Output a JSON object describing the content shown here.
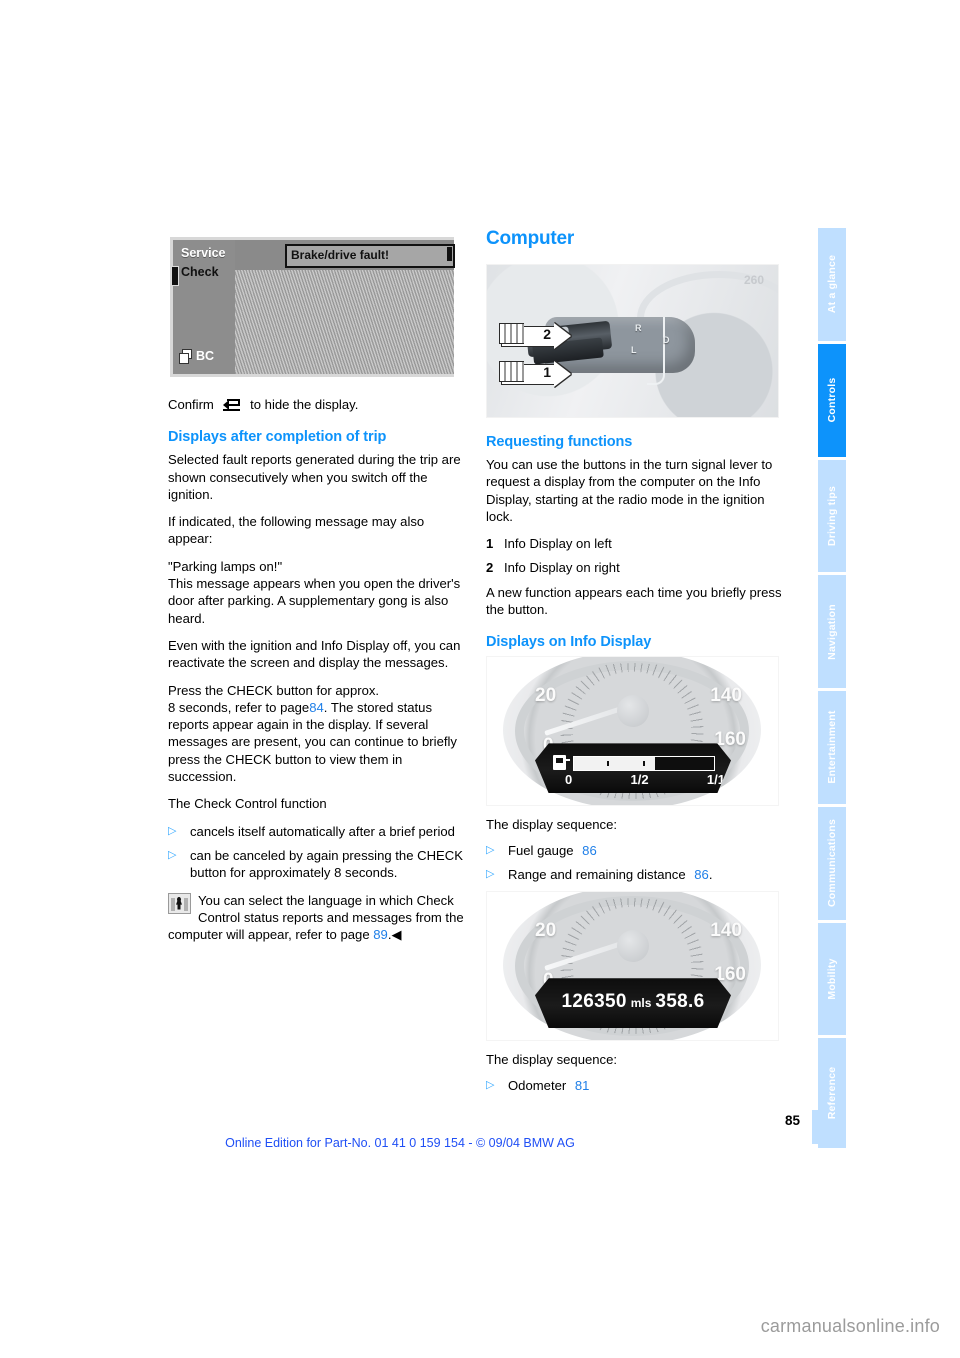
{
  "document": {
    "page_number": "85",
    "footer_note": "Online Edition for Part-No. 01 41 0 159 154 - © 09/04 BMW AG",
    "watermark": "carmanualsonline.info"
  },
  "colors": {
    "heading_blue": "#0d93fb",
    "tab_active": "#0d93fb",
    "tab_inactive": "#bfdfff",
    "page_ref_blue": "#1f7fe8",
    "footer_blue": "#1f4ff5"
  },
  "sidebar": {
    "tabs": [
      {
        "label": "At a glance",
        "active": false
      },
      {
        "label": "Controls",
        "active": true
      },
      {
        "label": "Driving tips",
        "active": false
      },
      {
        "label": "Navigation",
        "active": false
      },
      {
        "label": "Entertainment",
        "active": false
      },
      {
        "label": "Communications",
        "active": false
      },
      {
        "label": "Mobility",
        "active": false
      },
      {
        "label": "Reference",
        "active": false
      }
    ]
  },
  "left_column": {
    "figure_check_control": {
      "service_label": "Service",
      "check_label": "Check",
      "bc_label": "BC",
      "message": "Brake/drive fault!"
    },
    "confirm_line_before": "Confirm",
    "confirm_line_after": "to hide the display.",
    "section_heading": "Displays after completion of trip",
    "paragraphs": [
      "Selected fault reports generated during the trip are shown consecutively when you switch off the ignition.",
      "If indicated, the following message may also appear:",
      "\"Parking lamps on!\"\nThis message appears when you open the driver's door after parking. A supplementary gong is also heard.",
      "Even with the ignition and Info Display off, you can reactivate the screen and display the messages."
    ],
    "press_check_part1": "Press the CHECK button for approx.",
    "press_check_part2a": "8 seconds, refer to page",
    "press_check_ref": "84",
    "press_check_part2b": ". The stored status reports appear again in the display. If several messages are present, you can continue to briefly press the CHECK button to view them in succession.",
    "check_control_intro": "The Check Control function",
    "bullets": [
      "cancels itself automatically after a brief period",
      "can be canceled by again pressing the CHECK button for approximately 8 seconds."
    ],
    "note_text_a": "You can select the language in which Check Control status reports and messages from the computer will appear, refer to page",
    "note_ref": "89",
    "note_end": ".◀"
  },
  "right_column": {
    "title": "Computer",
    "figure_stalk": {
      "callout_1": "1",
      "callout_2": "2",
      "speed_mark": "260"
    },
    "requesting_heading": "Requesting functions",
    "requesting_paragraph": "You can use the buttons in the turn signal lever to request a display from the computer on the Info Display, starting at the radio mode in the ignition lock.",
    "numbered_items": [
      {
        "num": "1",
        "text": "Info Display on left"
      },
      {
        "num": "2",
        "text": "Info Display on right"
      }
    ],
    "new_function_paragraph": "A new function appears each time you briefly press the button.",
    "displays_heading": "Displays on Info Display",
    "cluster_fuel": {
      "speed_20": "20",
      "speed_0": "0",
      "speed_140": "140",
      "speed_160": "160",
      "scale_empty": "0",
      "scale_half": "1/2",
      "scale_full": "1/1"
    },
    "sequence_1_label": "The display sequence:",
    "sequence_1_items": [
      {
        "text": "Fuel gauge",
        "ref": "86",
        "tail": ""
      },
      {
        "text": "Range and remaining distance",
        "ref": "86",
        "tail": "."
      }
    ],
    "cluster_odometer": {
      "speed_20": "20",
      "speed_0": "0",
      "speed_140": "140",
      "speed_160": "160",
      "odometer_value": "126350",
      "odometer_unit": "mls",
      "trip_value": "358.6"
    },
    "sequence_2_label": "The display sequence:",
    "sequence_2_items": [
      {
        "text": "Odometer",
        "ref": "81",
        "tail": ""
      }
    ]
  }
}
